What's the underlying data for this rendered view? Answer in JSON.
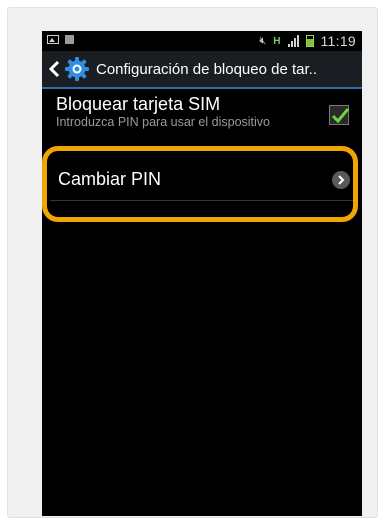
{
  "status_bar": {
    "time": "11:19",
    "network_label": "H",
    "icons": [
      "image-icon",
      "box-icon",
      "mute-icon",
      "signal-icon",
      "battery-icon"
    ]
  },
  "action_bar": {
    "title": "Configuración de bloqueo de tar..",
    "icons": [
      "back-icon",
      "gear-icon"
    ],
    "accent_color": "#2a6fb0"
  },
  "settings": {
    "sim_lock": {
      "title": "Bloquear tarjeta SIM",
      "subtitle": "Introduzca PIN para usar el dispositivo",
      "checked": true
    },
    "change_pin": {
      "title": "Cambiar PIN"
    }
  },
  "annotation": {
    "highlight_color": "#f0a500"
  }
}
